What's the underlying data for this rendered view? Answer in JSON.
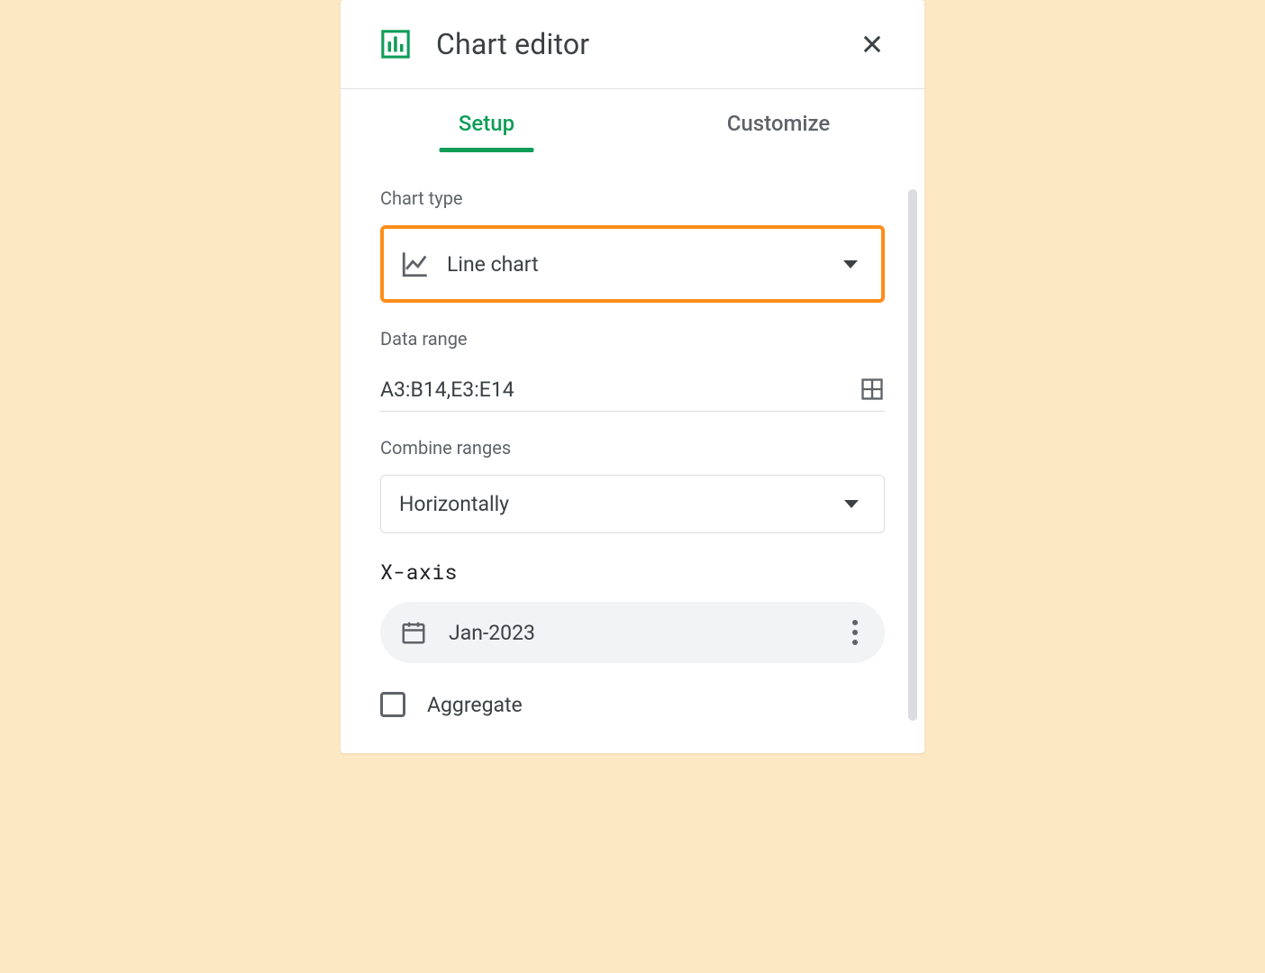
{
  "header": {
    "title": "Chart editor"
  },
  "tabs": {
    "setup": "Setup",
    "customize": "Customize"
  },
  "setup": {
    "chart_type_label": "Chart type",
    "chart_type_value": "Line chart",
    "data_range_label": "Data range",
    "data_range_value": "A3:B14,E3:E14",
    "combine_ranges_label": "Combine ranges",
    "combine_ranges_value": "Horizontally",
    "x_axis_label": "X-axis",
    "x_axis_value": "Jan-2023",
    "aggregate_label": "Aggregate"
  }
}
